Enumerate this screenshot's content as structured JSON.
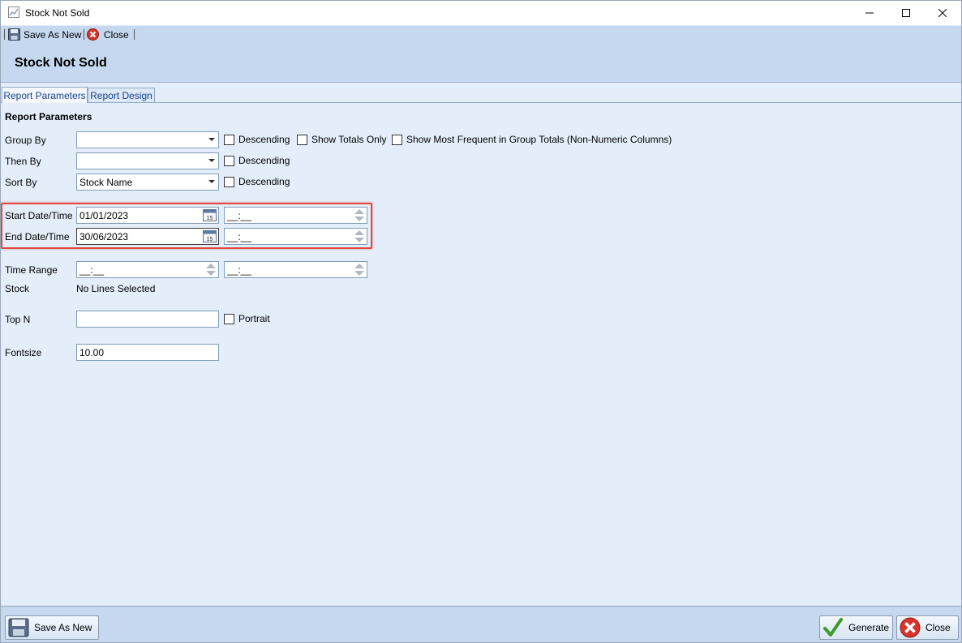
{
  "window": {
    "title": "Stock Not Sold",
    "controls": {
      "minimize": "minimize-icon",
      "maximize": "maximize-icon",
      "close": "close-icon"
    }
  },
  "toolbar": {
    "save_as_new": "Save As New",
    "close": "Close"
  },
  "header": {
    "title": "Stock Not Sold"
  },
  "tabs": [
    {
      "label": "Report Parameters",
      "active": true
    },
    {
      "label": "Report Design",
      "active": false
    }
  ],
  "params": {
    "section_title": "Report Parameters",
    "group_by": {
      "label": "Group By",
      "value": ""
    },
    "then_by": {
      "label": "Then By",
      "value": ""
    },
    "sort_by": {
      "label": "Sort By",
      "value": "Stock Name"
    },
    "descending_label": "Descending",
    "show_totals_only": "Show Totals Only",
    "show_most_frequent": "Show Most Frequent in Group Totals (Non-Numeric Columns)",
    "start_date": {
      "label": "Start Date/Time",
      "date": "01/01/2023",
      "time": "__:__"
    },
    "end_date": {
      "label": "End Date/Time",
      "date": "30/06/2023",
      "time": "__:__"
    },
    "time_range": {
      "label": "Time Range",
      "from": "__:__",
      "to": "__:__"
    },
    "stock": {
      "label": "Stock",
      "value": "No Lines Selected"
    },
    "top_n": {
      "label": "Top N",
      "value": ""
    },
    "portrait": "Portrait",
    "fontsize": {
      "label": "Fontsize",
      "value": "10.00"
    }
  },
  "footer": {
    "save_as_new": "Save As New",
    "generate": "Generate",
    "close": "Close"
  },
  "colors": {
    "panel_bg": "#e4eefa",
    "band_bg": "#c5d8ef",
    "highlight": "#e0463e",
    "tab_text": "#15428b"
  }
}
